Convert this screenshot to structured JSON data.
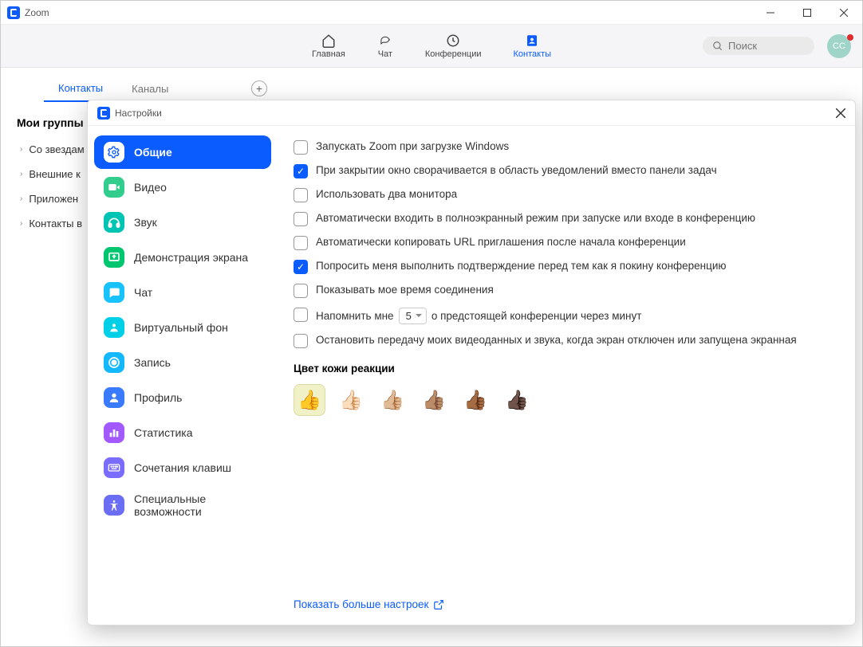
{
  "window": {
    "title": "Zoom"
  },
  "nav": {
    "items": [
      {
        "label": "Главная"
      },
      {
        "label": "Чат"
      },
      {
        "label": "Конференции"
      },
      {
        "label": "Контакты"
      }
    ],
    "search_placeholder": "Поиск",
    "avatar_initials": "CC"
  },
  "subtabs": {
    "contacts": "Контакты",
    "channels": "Каналы"
  },
  "groups": {
    "title": "Мои группы",
    "items": [
      {
        "label": "Со звездам"
      },
      {
        "label": "Внешние к"
      },
      {
        "label": "Приложен"
      },
      {
        "label": "Контакты в"
      }
    ]
  },
  "settings": {
    "title": "Настройки",
    "close": "×",
    "sidebar": [
      {
        "label": "Общие",
        "color": "#0b5cff",
        "icon": "gear"
      },
      {
        "label": "Видео",
        "color": "#32cd8d",
        "icon": "video"
      },
      {
        "label": "Звук",
        "color": "#00c4b3",
        "icon": "audio"
      },
      {
        "label": "Демонстрация экрана",
        "color": "#00c76f",
        "icon": "share"
      },
      {
        "label": "Чат",
        "color": "#17c2ff",
        "icon": "chat"
      },
      {
        "label": "Виртуальный фон",
        "color": "#00cfe8",
        "icon": "bg"
      },
      {
        "label": "Запись",
        "color": "#13b8ff",
        "icon": "rec"
      },
      {
        "label": "Профиль",
        "color": "#3a7aff",
        "icon": "profile"
      },
      {
        "label": "Статистика",
        "color": "#a259ff",
        "icon": "stats"
      },
      {
        "label": "Сочетания клавиш",
        "color": "#7a6cff",
        "icon": "keyboard"
      },
      {
        "label": "Специальные возможности",
        "color": "#6b6ef5",
        "icon": "a11y"
      }
    ],
    "options": [
      {
        "label": "Запускать Zoom при загрузке Windows",
        "checked": false
      },
      {
        "label": "При закрытии окно сворачивается в область уведомлений вместо панели задач",
        "checked": true
      },
      {
        "label": "Использовать два монитора",
        "checked": false
      },
      {
        "label": "Автоматически входить в полноэкранный режим при запуске или входе в конференцию",
        "checked": false
      },
      {
        "label": "Автоматически копировать URL приглашения после начала конференции",
        "checked": false
      },
      {
        "label": "Попросить меня выполнить подтверждение перед тем как я покину конференцию",
        "checked": true
      },
      {
        "label": "Показывать мое время соединения",
        "checked": false
      }
    ],
    "remind": {
      "prefix": "Напомнить мне",
      "value": "5",
      "suffix": "о предстоящей конференции через минут",
      "checked": false
    },
    "stop_share": {
      "label": "Остановить передачу моих видеоданных и звука, когда экран отключен или запущена экранная",
      "checked": false
    },
    "skin_label": "Цвет кожи реакции",
    "skins": [
      "👍",
      "👍🏻",
      "👍🏼",
      "👍🏽",
      "👍🏾",
      "👍🏿"
    ],
    "more": "Показать больше настроек"
  }
}
